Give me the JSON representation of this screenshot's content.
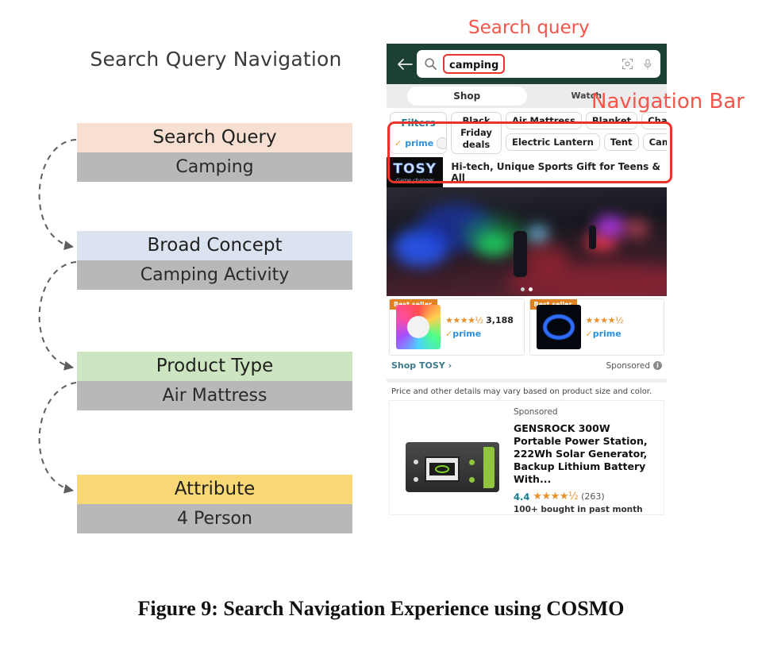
{
  "diagram": {
    "title": "Search Query Navigation",
    "boxes": [
      {
        "label": "Search Query",
        "value": "Camping",
        "color": "#f7e0d2"
      },
      {
        "label": "Broad Concept",
        "value": "Camping Activity",
        "color": "#dbe3f0"
      },
      {
        "label": "Product Type",
        "value": "Air Mattress",
        "color": "#cde5c0"
      },
      {
        "label": "Attribute",
        "value": "4 Person",
        "color": "#fad875"
      }
    ],
    "value_bg": "#b8b8b8"
  },
  "annotations": {
    "search_query": "Search query",
    "navigation_bar": "Navigation Bar",
    "color": "#f4564b"
  },
  "phone": {
    "search": {
      "back_icon": "back-arrow-icon",
      "search_icon": "search-icon",
      "query": "camping",
      "camera_icon": "camera-icon",
      "mic_icon": "microphone-icon",
      "header_color": "#1d4036"
    },
    "tabs": [
      {
        "label": "Shop",
        "active": true
      },
      {
        "label": "Watch",
        "active": false
      }
    ],
    "filters": {
      "title": "Filters",
      "prime_label": "prime",
      "prime_enabled": false,
      "black_friday": "Black Friday deals",
      "chips_row1": [
        "Air Mattress",
        "Blanket",
        "Chair"
      ],
      "chips_row2": [
        "Electric Lantern",
        "Tent",
        "Campi"
      ]
    },
    "brand_banner": {
      "logo_text": "TOSY",
      "logo_sub": "Game changer",
      "tagline": "Hi-tech, Unique Sports Gift for Teens & All"
    },
    "carousel_dots": 2,
    "product_cards": [
      {
        "badge": "Best seller",
        "stars": "★★★★½",
        "rating_count": "3,188",
        "prime": "prime"
      },
      {
        "badge": "Best seller",
        "stars": "★★★★½",
        "rating_count": "",
        "prime": "prime"
      }
    ],
    "shop_link": "Shop TOSY ›",
    "sponsored_label": "Sponsored",
    "price_notice": "Price and other details may vary based on product size and color.",
    "listing": {
      "sponsored": "Sponsored",
      "title": "GENSROCK 300W Portable Power Station, 222Wh Solar Generator, Backup Lithium Battery With...",
      "rating_value": "4.4",
      "stars": "★★★★½",
      "review_count": "(263)",
      "bought": "100+ bought in past month"
    }
  },
  "caption": "Figure 9: Search Navigation Experience using COSMO"
}
